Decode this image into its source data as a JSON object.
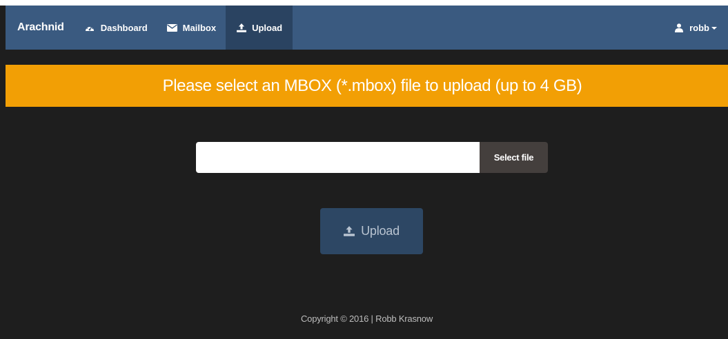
{
  "navbar": {
    "brand": "Arachnid",
    "items": [
      {
        "label": "Dashboard",
        "icon": "dashboard-icon",
        "active": false
      },
      {
        "label": "Mailbox",
        "icon": "envelope-icon",
        "active": false
      },
      {
        "label": "Upload",
        "icon": "upload-icon",
        "active": true
      }
    ],
    "user": {
      "label": "robb",
      "icon": "user-icon"
    }
  },
  "banner": {
    "text": "Please select an MBOX (*.mbox) file to upload (up to 4 GB)"
  },
  "file_picker": {
    "value": "",
    "placeholder": "",
    "button_label": "Select file"
  },
  "upload_button": {
    "label": "Upload",
    "icon": "upload-icon"
  },
  "footer": {
    "text": "Copyright © 2016 | Robb Krasnow"
  },
  "colors": {
    "navbar": "#3a5a80",
    "navbar_active": "#2a4361",
    "banner": "#f29f05",
    "background": "#1e1e1e",
    "upload_button": "#2d4764",
    "select_file_button": "#443f3d"
  }
}
